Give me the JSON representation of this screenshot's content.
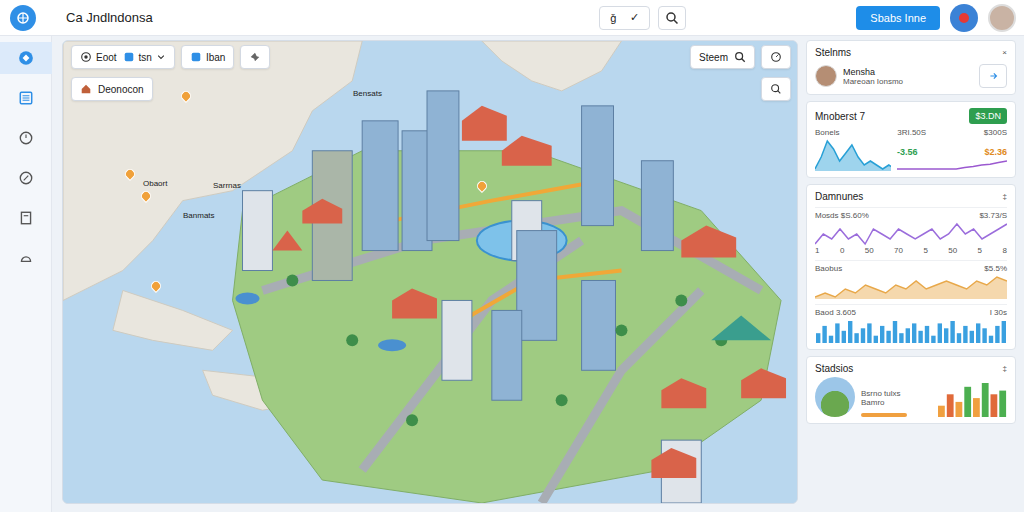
{
  "window": {
    "title": "Ca Jndlndonsa"
  },
  "toolbar": {
    "tools": [
      "ǧ",
      "✓"
    ],
    "action": "Sbabs Inne"
  },
  "sidebar": {
    "items": [
      {
        "selected": true
      },
      {
        "selected": false
      },
      {
        "selected": false
      },
      {
        "selected": false
      },
      {
        "selected": false
      },
      {
        "selected": false
      }
    ]
  },
  "map": {
    "controls": [
      {
        "label": "Eoot",
        "kind": "button"
      },
      {
        "label": "tsn",
        "kind": "dropdown"
      },
      {
        "label": "Iban",
        "kind": "button"
      }
    ],
    "chip": "Deonocon",
    "search": "Steem",
    "labels": [
      "Bensats",
      "Obaort",
      "Sarrnas",
      "Banmats"
    ]
  },
  "panel": {
    "header": {
      "title": "Stelnms",
      "close": "×"
    },
    "user": {
      "name": "Mensha",
      "subtitle": "Mareoan Ionsmo"
    },
    "metric": {
      "title": "Mnoberst 7",
      "badge": "$3.DN",
      "label": "Bonels",
      "value": "3RI.50S",
      "value2": "$300S",
      "change": "-3.56",
      "amount": "$2.36",
      "series": [
        {
          "values": [
            2,
            5,
            9,
            7,
            4,
            6,
            8,
            5,
            3,
            4,
            3,
            2,
            3,
            2
          ],
          "color": "#28a0d6"
        },
        {
          "values": [
            3,
            3,
            3,
            3,
            3,
            3,
            3,
            3,
            3.2,
            3.3,
            3.5,
            3.6,
            3.8,
            4
          ],
          "color": "#9b59d0"
        }
      ]
    },
    "trends": {
      "title": "Damnunes",
      "menu": "‡",
      "charts": [
        {
          "kind": "line",
          "label": "Mosds $S.60%",
          "value": "$3.73/S",
          "values": [
            4,
            6,
            5,
            7,
            5,
            6,
            4,
            7,
            6,
            5,
            7,
            6,
            5,
            6,
            7,
            5,
            6,
            8,
            6,
            7,
            5,
            6,
            7,
            8
          ],
          "color": "#9b6ddc",
          "ticks": [
            "1",
            "0",
            "50",
            "70",
            "5",
            "50",
            "5",
            "8"
          ]
        },
        {
          "kind": "area",
          "label": "Baobus",
          "value": "$5.5%",
          "values": [
            3,
            4,
            3,
            5,
            4,
            6,
            5,
            4,
            6,
            5,
            7,
            5,
            6,
            7,
            6,
            5,
            7,
            6,
            8,
            7
          ],
          "color": "#e8a84a"
        },
        {
          "kind": "bars",
          "label": "Baod 3.605",
          "value": "I 30s",
          "values": [
            4,
            7,
            3,
            8,
            5,
            9,
            4,
            6,
            8,
            3,
            7,
            5,
            9,
            4,
            6,
            8,
            5,
            7,
            3,
            8,
            6,
            9,
            4,
            7,
            5,
            8,
            6,
            3,
            7,
            9
          ],
          "color": "#3aa0e0"
        }
      ]
    },
    "stats": {
      "title": "Stadsios",
      "menu": "‡",
      "lines": [
        "Bsrno tulxs",
        "Bamro"
      ],
      "bars": [
        {
          "value": 3,
          "color": "#f0a040"
        },
        {
          "value": 6,
          "color": "#e06a3a"
        },
        {
          "value": 4,
          "color": "#f0a040"
        },
        {
          "value": 8,
          "color": "#4caf50"
        },
        {
          "value": 5,
          "color": "#f0a040"
        },
        {
          "value": 9,
          "color": "#4caf50"
        },
        {
          "value": 6,
          "color": "#e06a3a"
        },
        {
          "value": 7,
          "color": "#4caf50"
        }
      ]
    }
  }
}
